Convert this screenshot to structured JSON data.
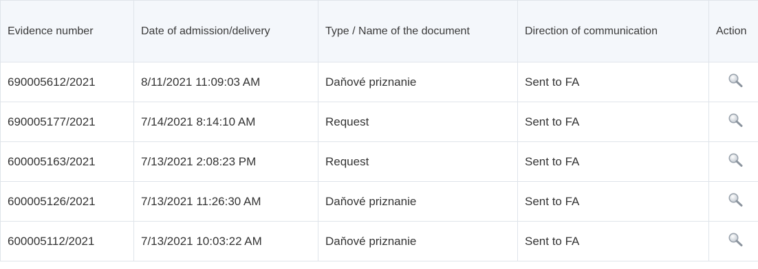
{
  "table": {
    "headers": [
      "Evidence number",
      "Date of admission/delivery",
      "Type / Name of the document",
      "Direction of communication",
      "Action"
    ],
    "rows": [
      {
        "evidence": "690005612/2021",
        "date": "8/11/2021 11:09:03 AM",
        "type": "Daňové priznanie",
        "direction": "Sent to FA",
        "action_icon": "search-icon"
      },
      {
        "evidence": "690005177/2021",
        "date": "7/14/2021 8:14:10 AM",
        "type": "Request",
        "direction": "Sent to FA",
        "action_icon": "search-icon"
      },
      {
        "evidence": "600005163/2021",
        "date": "7/13/2021 2:08:23 PM",
        "type": "Request",
        "direction": "Sent to FA",
        "action_icon": "search-icon"
      },
      {
        "evidence": "600005126/2021",
        "date": "7/13/2021 11:26:30 AM",
        "type": "Daňové priznanie",
        "direction": "Sent to FA",
        "action_icon": "search-icon"
      },
      {
        "evidence": "600005112/2021",
        "date": "7/13/2021 10:03:22 AM",
        "type": "Daňové priznanie",
        "direction": "Sent to FA",
        "action_icon": "search-icon"
      }
    ]
  },
  "colors": {
    "header_bg": "#f4f7fb",
    "border": "#dfe4ea",
    "text": "#333333"
  }
}
